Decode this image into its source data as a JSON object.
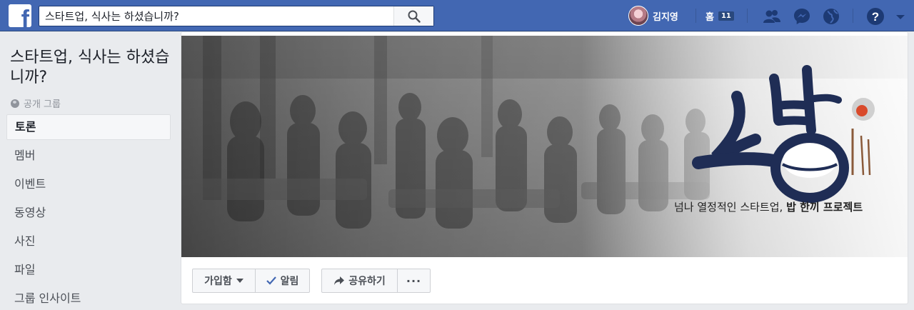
{
  "topbar": {
    "logo_letter": "f",
    "search_value": "스타트업, 식사는 하셨습니까?",
    "profile_name": "김지영",
    "home_label": "홈",
    "home_count": "11"
  },
  "sidebar": {
    "group_title": "스타트업, 식사는 하셨습니까?",
    "privacy": "공개 그룹",
    "items": [
      {
        "label": "토론",
        "active": true
      },
      {
        "label": "멤버"
      },
      {
        "label": "이벤트"
      },
      {
        "label": "동영상"
      },
      {
        "label": "사진"
      },
      {
        "label": "파일"
      },
      {
        "label": "그룹 인사이트"
      }
    ]
  },
  "cover": {
    "tagline_normal": "넘나 열정적인 스타트업, ",
    "tagline_bold": "밥 한끼 프로젝트"
  },
  "actions": {
    "join": "가입함",
    "notify": "알림",
    "share": "공유하기",
    "more": "···"
  },
  "colors": {
    "brand": "#4267b2",
    "background": "#e9ebee"
  }
}
